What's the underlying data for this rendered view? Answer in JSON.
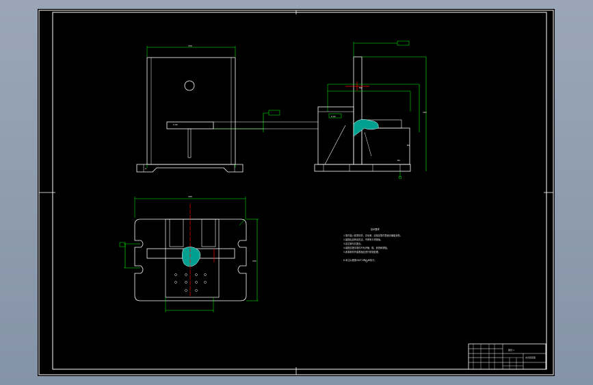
{
  "window": {
    "background_color": "#8c9ab0"
  },
  "title_block": {
    "drawing_number": "图纸-1",
    "part_name": "夹具装配图"
  },
  "notes": {
    "heading": "技术要求",
    "items": [
      "1.零件装入前须清洗，去毛刺，应保证零件表面无磕碰划伤。",
      "2.装配后应转动灵活，不得有卡滞现象。",
      "3.定位销与孔配合。",
      "4.装配过程中零件不允许磕、碰、划伤和锈蚀。",
      "5.各零部件外露表面应进行防锈处理。",
      "6.未注公差按GB/T1804-m执行。"
    ]
  },
  "colors": {
    "background": "#000000",
    "outline": "#ffffff",
    "dimension": "#00ff00",
    "centerline": "#ff0000",
    "notes_text": "#e8e8e8"
  }
}
